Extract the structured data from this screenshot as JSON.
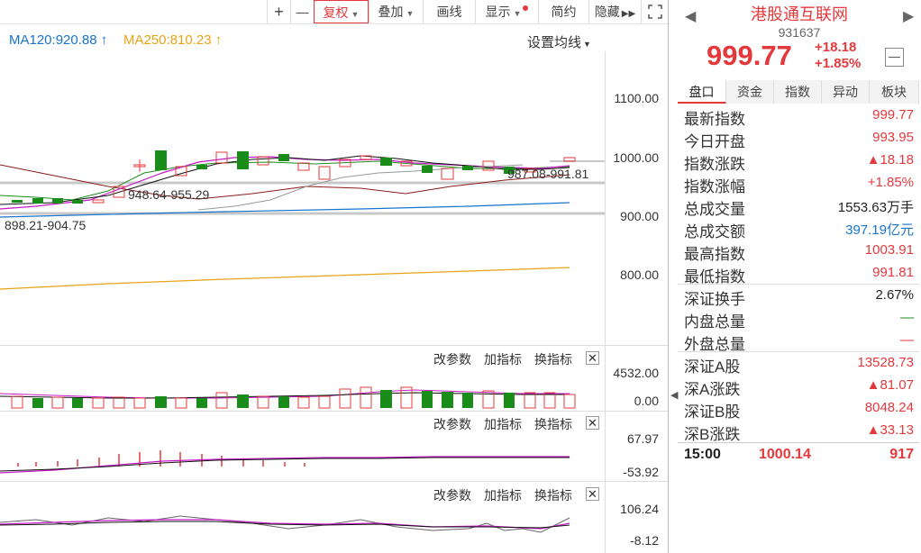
{
  "toolbar": {
    "plus": "+",
    "minus": "—",
    "fuquan": "复权",
    "diejia": "叠加",
    "huaxian": "画线",
    "xianshi": "显示",
    "jianyue": "简约",
    "yincang": "隐藏"
  },
  "ma": {
    "ma120": "MA120:920.88",
    "ma250": "MA250:810.23",
    "settings": "设置均线"
  },
  "price_axis": [
    "1100.00",
    "1000.00",
    "900.00",
    "800.00"
  ],
  "annotations": {
    "range1": "948.64-955.29",
    "range2": "898.21-904.75",
    "range3": "987.08-991.81"
  },
  "panels": {
    "gaicanshu": "改参数",
    "jiazhibiao": "加指标",
    "huanzhibiao": "换指标",
    "close": "✕",
    "panel1_top": "4532.00",
    "panel1_bottom": "0.00",
    "panel2_top": "67.97",
    "panel2_bottom": "-53.92",
    "panel3_top": "106.24",
    "panel3_bottom": "-8.12"
  },
  "colors": {
    "up": "#e4393c",
    "down": "#1a8c1a",
    "ma120": "#1874cd",
    "ma250": "#e8a317"
  },
  "quote": {
    "name": "港股通互联网",
    "code": "931637",
    "price": "999.77",
    "change": "+18.18",
    "change_pct": "+1.85%",
    "collapse": "—"
  },
  "tabs": [
    "盘口",
    "资金",
    "指数",
    "异动",
    "板块"
  ],
  "stats": [
    {
      "label": "最新指数",
      "value": "999.77",
      "color": "red"
    },
    {
      "label": "今日开盘",
      "value": "993.95",
      "color": "red"
    },
    {
      "label": "指数涨跌",
      "value": "▲18.18",
      "color": "red"
    },
    {
      "label": "指数涨幅",
      "value": "+1.85%",
      "color": "red"
    },
    {
      "label": "总成交量",
      "value": "1553.63万手",
      "color": "black"
    },
    {
      "label": "总成交额",
      "value": "397.19亿元",
      "color": "blue"
    },
    {
      "label": "最高指数",
      "value": "1003.91",
      "color": "red"
    },
    {
      "label": "最低指数",
      "value": "991.81",
      "color": "red"
    },
    {
      "label": "深证换手",
      "value": "2.67%",
      "color": "black"
    },
    {
      "label": "内盘总量",
      "value": "—",
      "color": "green"
    },
    {
      "label": "外盘总量",
      "value": "—",
      "color": "red"
    },
    {
      "label": "深证A股",
      "value": "13528.73",
      "color": "red"
    },
    {
      "label": "深A涨跌",
      "value": "▲81.07",
      "color": "red"
    },
    {
      "label": "深证B股",
      "value": "8048.24",
      "color": "red"
    },
    {
      "label": "深B涨跌",
      "value": "▲33.13",
      "color": "red"
    }
  ],
  "tick": {
    "time": "15:00",
    "price": "1000.14",
    "volume": "917"
  }
}
